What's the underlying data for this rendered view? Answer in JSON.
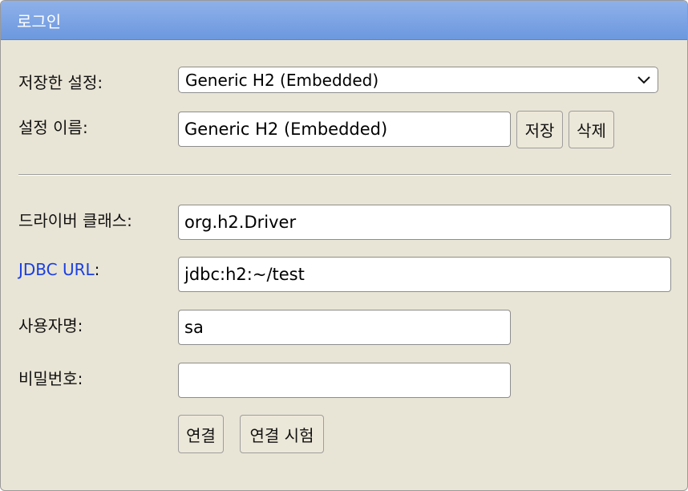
{
  "window": {
    "title": "로그인"
  },
  "saved_settings": {
    "label": "저장한 설정:",
    "selected": "Generic H2 (Embedded)"
  },
  "setting_name": {
    "label": "설정 이름:",
    "value": "Generic H2 (Embedded)",
    "save_label": "저장",
    "delete_label": "삭제"
  },
  "driver_class": {
    "label": "드라이버 클래스:",
    "value": "org.h2.Driver"
  },
  "jdbc_url": {
    "link_text": "JDBC URL",
    "suffix": ":",
    "value": "jdbc:h2:~/test"
  },
  "username": {
    "label": "사용자명:",
    "value": "sa"
  },
  "password": {
    "label": "비밀번호:",
    "value": ""
  },
  "actions": {
    "connect_label": "연결",
    "test_label": "연결 시험"
  },
  "icons": {
    "dropdown": "chevron-down-icon"
  }
}
